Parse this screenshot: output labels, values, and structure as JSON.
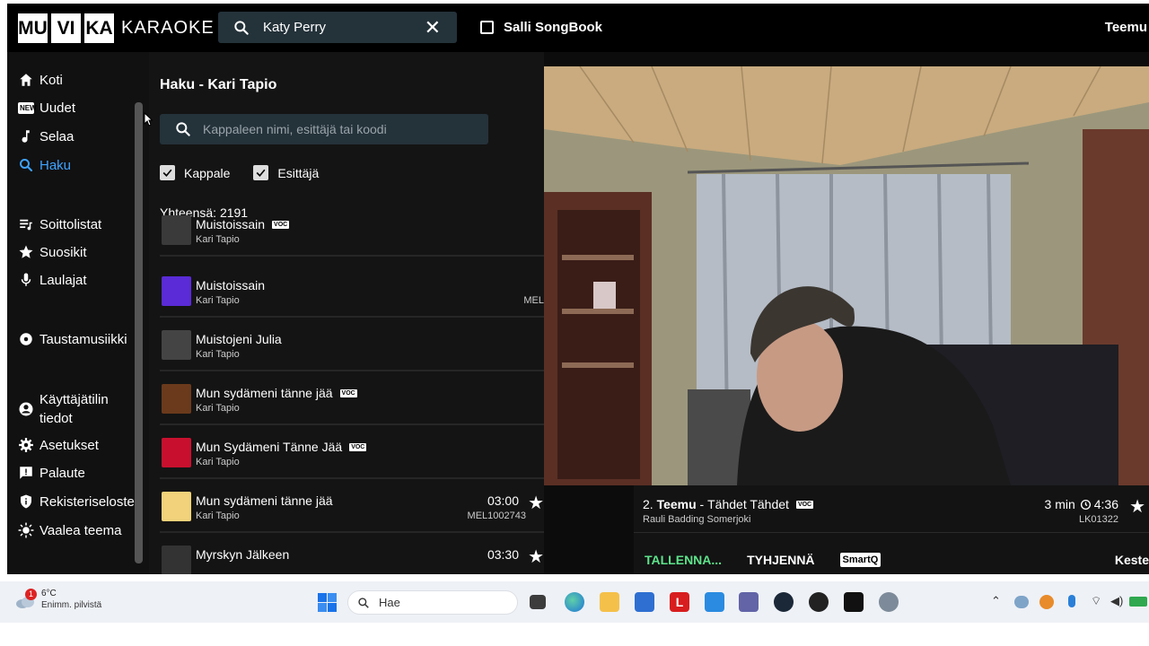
{
  "app": {
    "logo_letters": [
      "MU",
      "VI",
      "KA"
    ],
    "logo_word": "KARAOKE",
    "search_value": "Katy Perry",
    "songbook_label": "Salli SongBook",
    "user_name": "Teemu"
  },
  "sidebar": {
    "items": [
      {
        "label": "Koti",
        "icon": "home-icon"
      },
      {
        "label": "Uudet",
        "icon": "new-icon"
      },
      {
        "label": "Selaa",
        "icon": "music-note-icon"
      },
      {
        "label": "Haku",
        "icon": "search-icon",
        "active": true
      },
      {
        "label": "Soittolistat",
        "icon": "playlist-icon"
      },
      {
        "label": "Suosikit",
        "icon": "star-icon"
      },
      {
        "label": "Laulajat",
        "icon": "microphone-icon"
      },
      {
        "label": "Taustamusiikki",
        "icon": "disc-icon"
      },
      {
        "label": "Käyttäjätilin",
        "label2": "tiedot",
        "icon": "account-icon"
      },
      {
        "label": "Asetukset",
        "icon": "gear-icon"
      },
      {
        "label": "Palaute",
        "icon": "feedback-icon"
      },
      {
        "label": "Rekisteriseloste",
        "icon": "shield-icon"
      },
      {
        "label": "Vaalea teema",
        "icon": "sun-icon"
      }
    ],
    "new_badge": "NEW"
  },
  "search_panel": {
    "title": "Haku - Kari Tapio",
    "placeholder": "Kappaleen nimi, esittäjä tai koodi",
    "filter_song": "Kappale",
    "filter_artist": "Esittäjä",
    "total": "Yhteensä: 2191",
    "voc_badge": "VOC",
    "results": [
      {
        "title": "Muistoissain",
        "artist": "Kari Tapio",
        "voc": true,
        "duration": "",
        "code": "",
        "thumb": "#3a3a3a"
      },
      {
        "title": "Muistoissain",
        "artist": "Kari Tapio",
        "voc": false,
        "duration": "",
        "code": "MEL",
        "thumb": "#5a2bd6"
      },
      {
        "title": "Muistojeni Julia",
        "artist": "Kari Tapio",
        "voc": false,
        "duration": "",
        "code": "",
        "thumb": "#444444"
      },
      {
        "title": "Mun sydämeni tänne jää",
        "artist": "Kari Tapio",
        "voc": true,
        "duration": "",
        "code": "",
        "thumb": "#6b3a1c"
      },
      {
        "title": "Mun Sydämeni Tänne Jää",
        "artist": "Kari Tapio",
        "voc": true,
        "duration": "",
        "code": "",
        "thumb": "#c8102e"
      },
      {
        "title": "Mun sydämeni tänne jää",
        "artist": "Kari Tapio",
        "voc": false,
        "duration": "03:00",
        "code": "MEL1002743",
        "thumb": "#f2d27a"
      },
      {
        "title": "Myrskyn Jälkeen",
        "artist": "",
        "voc": false,
        "duration": "03:30",
        "code": "",
        "thumb": "#333333"
      }
    ]
  },
  "queue": {
    "index": "2.",
    "singer": "Teemu",
    "separator": " - ",
    "song": "Tähdet Tähdet",
    "artist": "Rauli Badding Somerjoki",
    "wait": "3 min",
    "time": "4:36",
    "code": "LK01322",
    "save_label": "TALLENNA...",
    "clear_label": "TYHJENNÄ",
    "smartq_label": "SmartQ",
    "continue_label": "Keste"
  },
  "taskbar": {
    "temp": "6°C",
    "weather": "Enimm. pilvistä",
    "notification_count": "1",
    "search_placeholder": "Hae"
  },
  "colors": {
    "accent_blue": "#3fa3ff",
    "save_green": "#5de38a",
    "search_bg": "#24323a"
  }
}
